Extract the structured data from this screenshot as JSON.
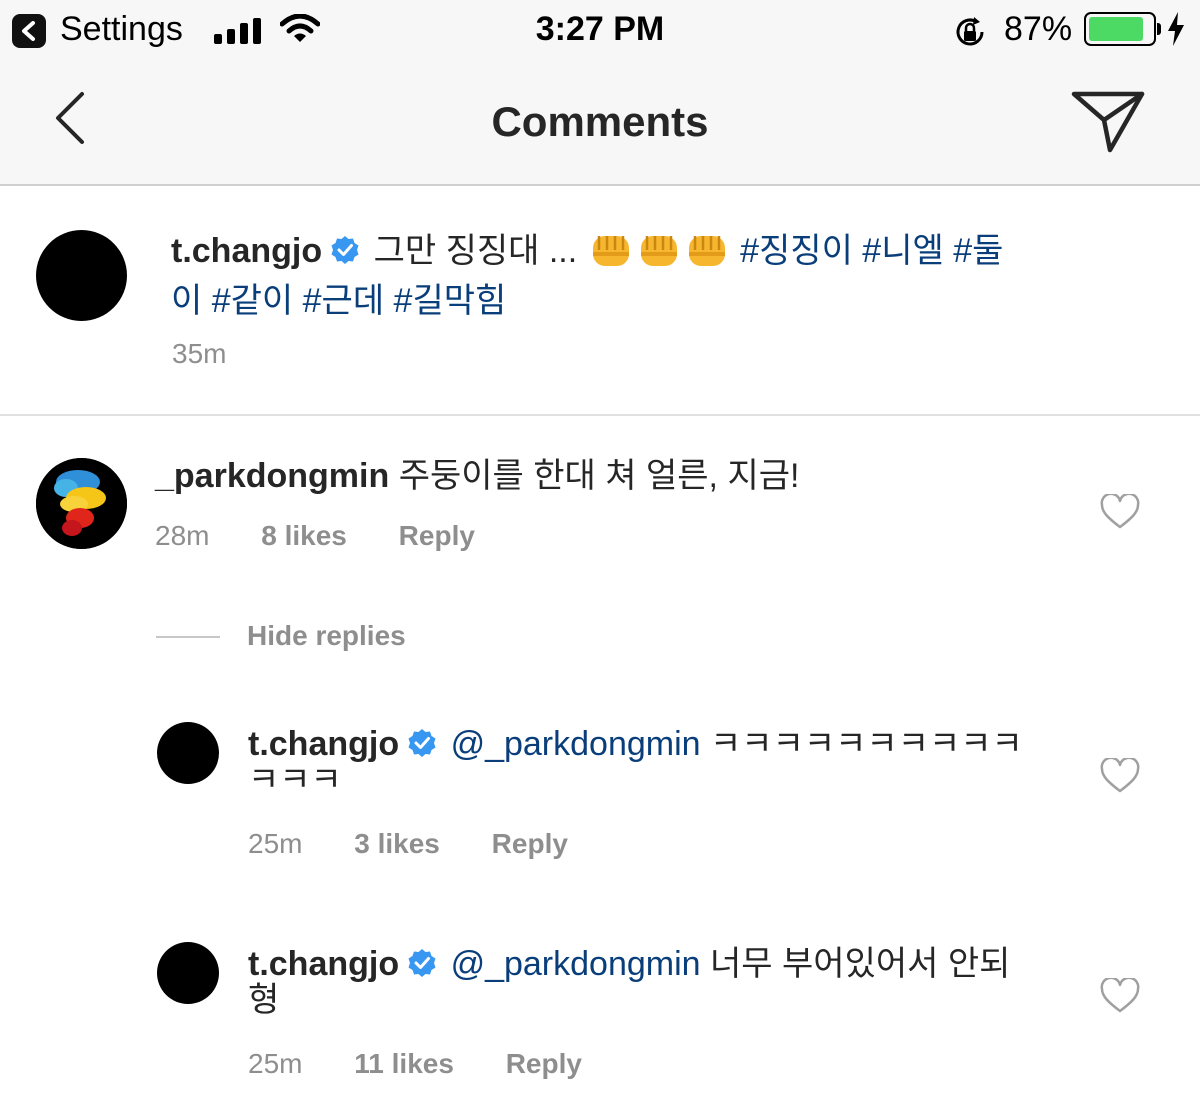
{
  "status_bar": {
    "back_app": "Settings",
    "time": "3:27 PM",
    "battery_percent": "87%",
    "battery_level": 0.87,
    "icons": [
      "signal-icon",
      "wifi-icon",
      "orientation-lock-icon",
      "battery-icon",
      "charging-icon"
    ]
  },
  "nav": {
    "title": "Comments",
    "back_icon": "chevron-left-icon",
    "send_icon": "direct-send-icon"
  },
  "caption": {
    "username": "t.changjo",
    "text": "그만 징징대 ...",
    "emojis": [
      "👊",
      "👊",
      "👊"
    ],
    "hashtags_line1": "#징징이 #니엘 #둘",
    "hashtags_line2": "이 #같이 #근데 #길막힘",
    "time": "35m"
  },
  "comments": [
    {
      "username": "_parkdongmin",
      "text": "주둥이를 한대 쳐 얼른, 지금!",
      "time": "28m",
      "likes": "8 likes",
      "reply": "Reply"
    }
  ],
  "hide_replies": "Hide replies",
  "replies": [
    {
      "username": "t.changjo",
      "mention": "@_parkdongmin",
      "text_line1": "ㅋㅋㅋㅋㅋㅋㅋㅋㅋㅋ",
      "text_line2": "ㅋㅋㅋ",
      "time": "25m",
      "likes": "3 likes",
      "reply": "Reply"
    },
    {
      "username": "t.changjo",
      "mention": "@_parkdongmin",
      "text_line1": "너무 부어있어서 안되",
      "text_line2": "형",
      "time": "25m",
      "likes": "11 likes",
      "reply": "Reply"
    }
  ]
}
